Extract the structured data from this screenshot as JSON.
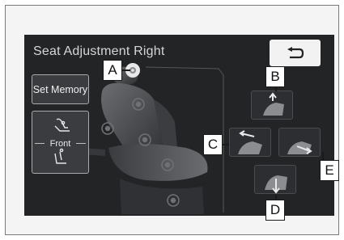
{
  "screen": {
    "title": "Seat Adjustment Right",
    "set_memory_label": "Set Memory",
    "front_label": "Front",
    "back_icon": "return-arrow-icon"
  },
  "callouts": {
    "a": "A",
    "b": "B",
    "c": "C",
    "d": "D",
    "e": "E"
  },
  "colors": {
    "screen_bg": "#232426",
    "text": "#d6d6d6",
    "back_button_bg": "#f2f2f2",
    "callout_bg": "#ffffff"
  }
}
